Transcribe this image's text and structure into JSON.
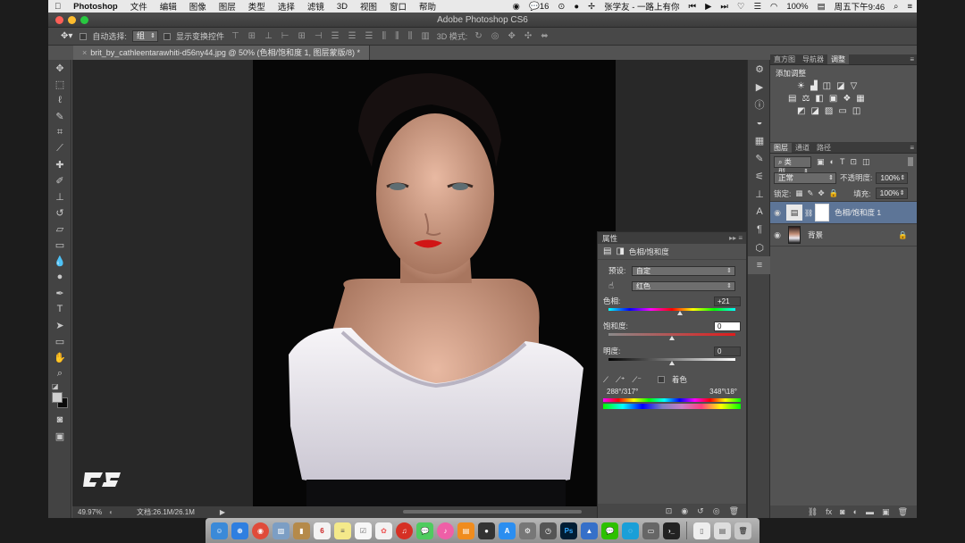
{
  "mac_menubar": {
    "apple": "",
    "items": [
      "Photoshop",
      "文件",
      "编辑",
      "图像",
      "图层",
      "类型",
      "选择",
      "滤镜",
      "3D",
      "视图",
      "窗口",
      "帮助"
    ],
    "status": {
      "qq_count": "16",
      "now_playing": "张学友 - 一路上有你",
      "battery": "100%",
      "clock": "周五下午9:46"
    }
  },
  "window": {
    "title": "Adobe Photoshop CS6"
  },
  "options_bar": {
    "auto_select_label": "自动选择:",
    "auto_select_value": "组",
    "show_transform_label": "显示变换控件",
    "mode_3d_label": "3D 模式:"
  },
  "document": {
    "tab_title": "brit_by_cathleentarawhiti-d56ny44.jpg @ 50% (色相/饱和度 1, 图层蒙版/8) *"
  },
  "status_bar": {
    "zoom": "49.97%",
    "doc_size": "文档:26.1M/26.1M"
  },
  "properties_panel": {
    "tab": "属性",
    "type_label": "色相/饱和度",
    "preset_label": "预设:",
    "preset_value": "自定",
    "channel_value": "红色",
    "hue_label": "色相:",
    "hue_value": "+21",
    "hue_level": 0.56,
    "saturation_label": "饱和度:",
    "saturation_value": "0",
    "saturation_level": 0.5,
    "lightness_label": "明度:",
    "lightness_value": "0",
    "lightness_level": 0.5,
    "colorize_label": "着色",
    "range_left": "288°/317°",
    "range_right": "348°\\18°"
  },
  "top_panel": {
    "tabs": [
      "直方图",
      "导航器",
      "调整"
    ],
    "active_tab": "调整",
    "heading": "添加调整"
  },
  "layers_panel": {
    "tabs": [
      "图层",
      "通道",
      "路径"
    ],
    "active_tab": "图层",
    "filter_value": "类型",
    "blend_mode": "正常",
    "opacity_label": "不透明度:",
    "opacity_value": "100%",
    "lock_label": "锁定:",
    "fill_label": "填充:",
    "fill_value": "100%",
    "layers": [
      {
        "name": "色相/饱和度 1",
        "selected": true
      },
      {
        "name": "背景",
        "selected": false
      }
    ]
  },
  "colors": {
    "accent": "#3b6ea5",
    "selected_layer": "#5d7597",
    "red_lips": "#d11515"
  }
}
